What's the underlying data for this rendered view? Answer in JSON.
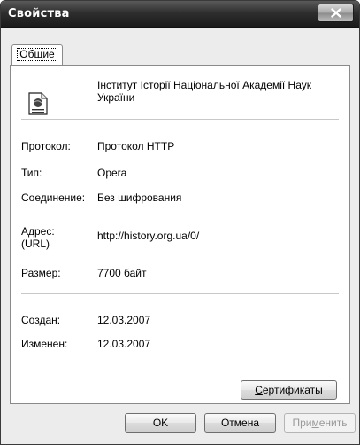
{
  "window": {
    "title": "Свойства",
    "close_symbol": "x"
  },
  "tabs": [
    {
      "label": "Общие",
      "active": true
    }
  ],
  "general": {
    "icon": "document-icon",
    "site_title": "Інститут Історії Національної Академії Наук України",
    "protocol": {
      "label": "Протокол:",
      "value": "Протокол HTTP"
    },
    "type": {
      "label": "Тип:",
      "value": "Opera"
    },
    "connection": {
      "label": "Соединение:",
      "value": "Без шифрования"
    },
    "address": {
      "label": "Адрес: (URL)",
      "value": "http://history.org.ua/0/"
    },
    "size": {
      "label": "Размер:",
      "value": "7700 байт"
    },
    "created": {
      "label": "Создан:",
      "value": "12.03.2007"
    },
    "modified": {
      "label": "Изменен:",
      "value": "12.03.2007"
    },
    "certificates_button": {
      "underlined": "С",
      "rest": "ертификаты"
    }
  },
  "buttons": {
    "ok": "OK",
    "cancel": "Отмена",
    "apply": {
      "before": "При",
      "underlined": "м",
      "after": "енить",
      "enabled": false
    }
  }
}
